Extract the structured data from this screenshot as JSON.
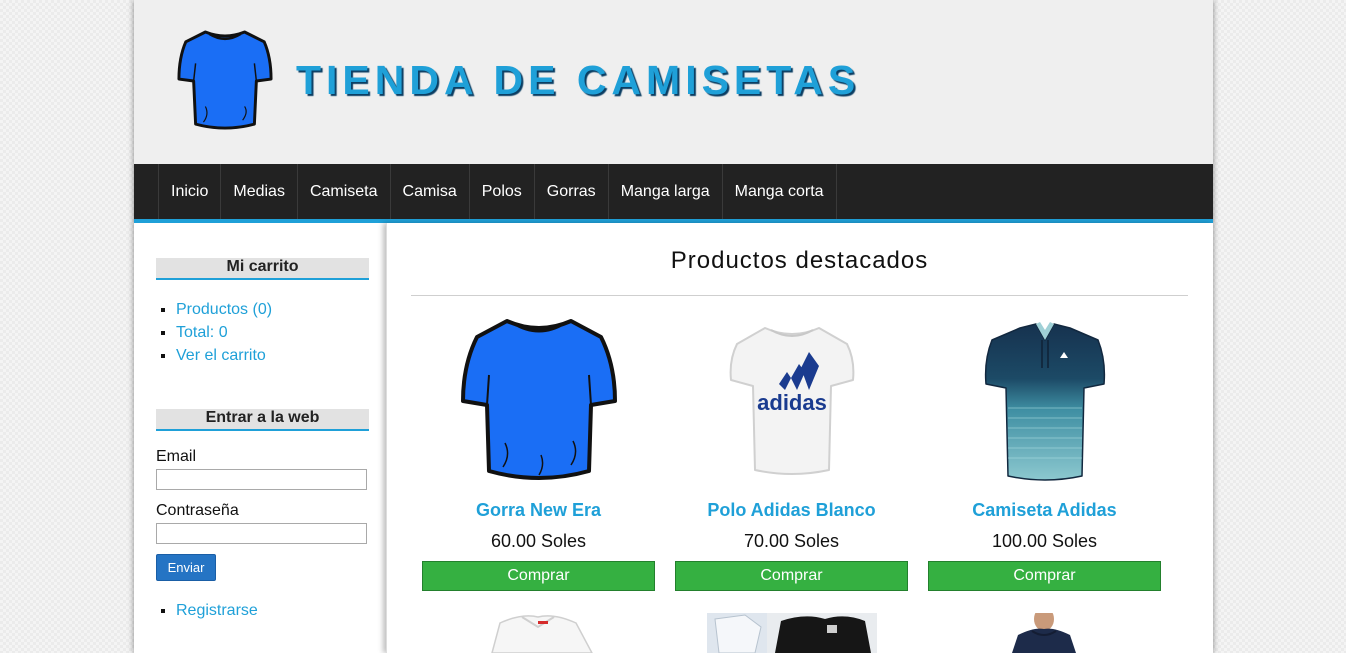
{
  "header": {
    "title": "TIENDA DE CAMISETAS",
    "logo_icon": "tshirt-icon",
    "logo_color": "#1a6ef5"
  },
  "nav": {
    "items": [
      "Inicio",
      "Medias",
      "Camiseta",
      "Camisa",
      "Polos",
      "Gorras",
      "Manga larga",
      "Manga corta"
    ]
  },
  "sidebar": {
    "cart": {
      "title": "Mi carrito",
      "items": [
        "Productos (0)",
        "Total: 0",
        "Ver el carrito"
      ]
    },
    "login": {
      "title": "Entrar a la web",
      "email_label": "Email",
      "email_value": "",
      "password_label": "Contraseña",
      "password_value": "",
      "submit_label": "Enviar",
      "register_link": "Registrarse"
    }
  },
  "main": {
    "title": "Productos destacados",
    "products": [
      {
        "name": "Gorra New Era",
        "price": "60.00 Soles",
        "button": "Comprar",
        "image": "blue-tshirt-image"
      },
      {
        "name": "Polo Adidas Blanco",
        "price": "70.00 Soles",
        "button": "Comprar",
        "image": "white-adidas-tshirt-image"
      },
      {
        "name": "Camiseta Adidas",
        "price": "100.00 Soles",
        "button": "Comprar",
        "image": "navy-teal-polo-image"
      }
    ],
    "partial_products": [
      "white-polo-image",
      "black-shirts-image",
      "navy-tshirt-model-image"
    ]
  },
  "colors": {
    "accent": "#1fa0d8",
    "nav_bg": "#222222",
    "buy_button": "#35b041",
    "submit_button": "#2574c4"
  }
}
